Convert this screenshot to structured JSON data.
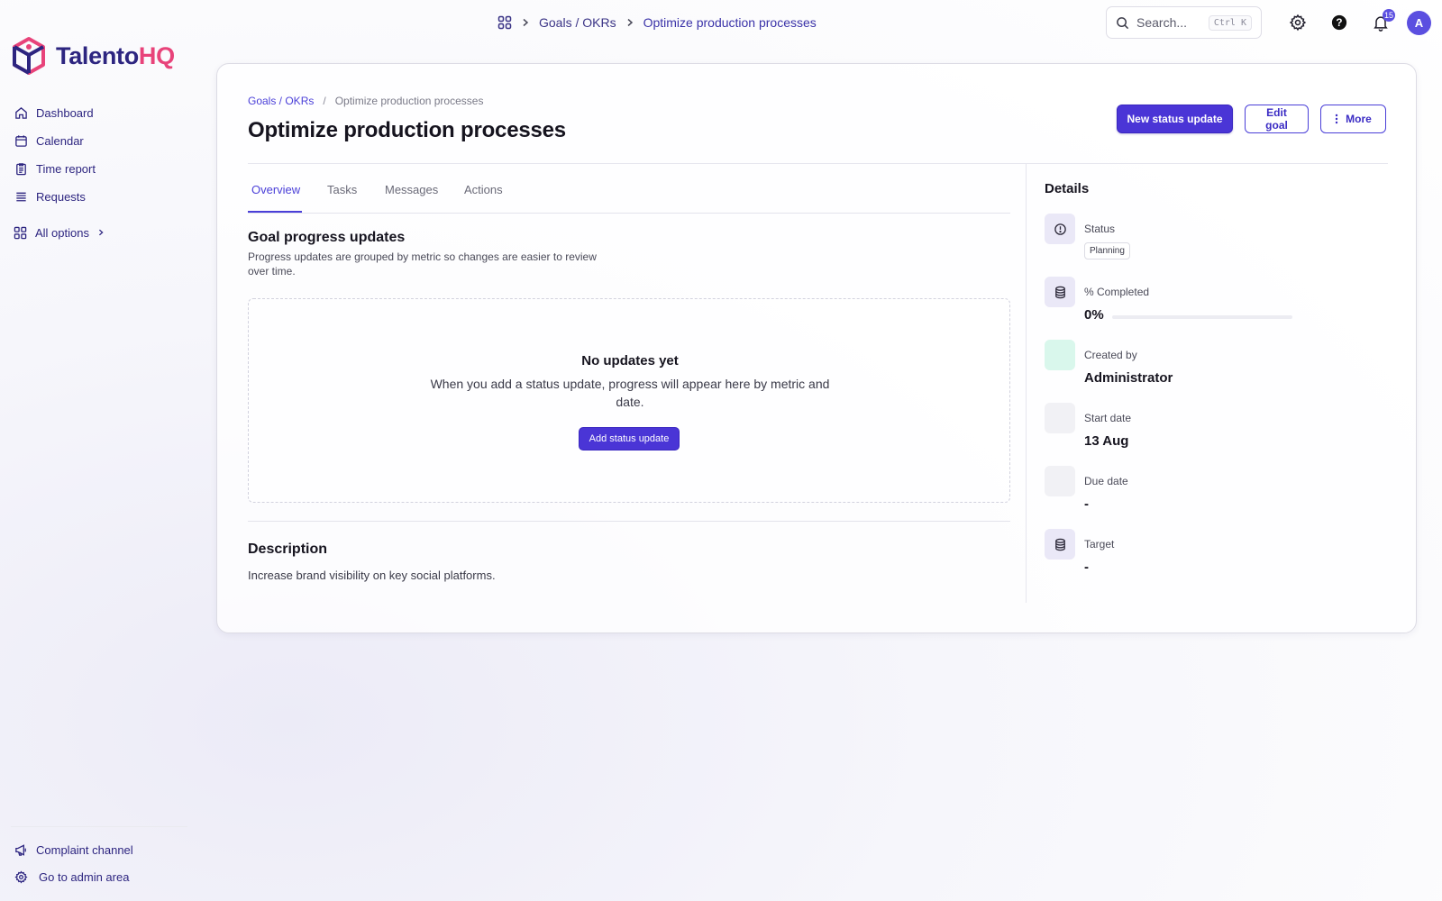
{
  "topbar": {
    "crumb_1": "Goals / OKRs",
    "crumb_2": "Optimize production processes",
    "search_placeholder": "Search...",
    "search_shortcut": "Ctrl K",
    "notification_count": "15",
    "avatar_initial": "A"
  },
  "logo": {
    "part1": "Talento",
    "part2": "HQ"
  },
  "sidebar": {
    "items": [
      {
        "label": "Dashboard",
        "icon": "home-icon"
      },
      {
        "label": "Calendar",
        "icon": "calendar-icon"
      },
      {
        "label": "Time report",
        "icon": "clipboard-icon"
      },
      {
        "label": "Requests",
        "icon": "list-icon"
      }
    ],
    "all_options": "All options",
    "bottom": [
      {
        "label": "Complaint channel",
        "icon": "megaphone-icon"
      },
      {
        "label": "Go to admin area",
        "icon": "gear-icon"
      }
    ]
  },
  "page": {
    "breadcrumb_parent": "Goals / OKRs",
    "breadcrumb_sep": "/",
    "breadcrumb_current": "Optimize production processes",
    "title": "Optimize production processes",
    "actions": {
      "new_status": "New status update",
      "edit": "Edit goal",
      "more": "More"
    },
    "tabs": [
      "Overview",
      "Tasks",
      "Messages",
      "Actions"
    ],
    "active_tab": "Overview",
    "progress_section": {
      "title": "Goal progress updates",
      "description": "Progress updates are grouped by metric so changes are easier to review over time."
    },
    "empty_state": {
      "title": "No updates yet",
      "message": "When you add a status update, progress will appear here by metric and date.",
      "button": "Add status update"
    },
    "description_section": {
      "title": "Description",
      "text": "Increase brand visibility on key social platforms."
    }
  },
  "details": {
    "title": "Details",
    "status": {
      "label": "Status",
      "value": "Planning"
    },
    "completed": {
      "label": "% Completed",
      "value": "0%",
      "fraction": 0
    },
    "created_by": {
      "label": "Created by",
      "value": "Administrator"
    },
    "start_date": {
      "label": "Start date",
      "value": "13 Aug"
    },
    "due_date": {
      "label": "Due date",
      "value": "-"
    },
    "target": {
      "label": "Target",
      "value": "-"
    }
  },
  "colors": {
    "brand_primary": "#4a35d6",
    "brand_navy": "#2d2580",
    "brand_pink": "#e8437a",
    "mint": "#d9f7ec"
  }
}
